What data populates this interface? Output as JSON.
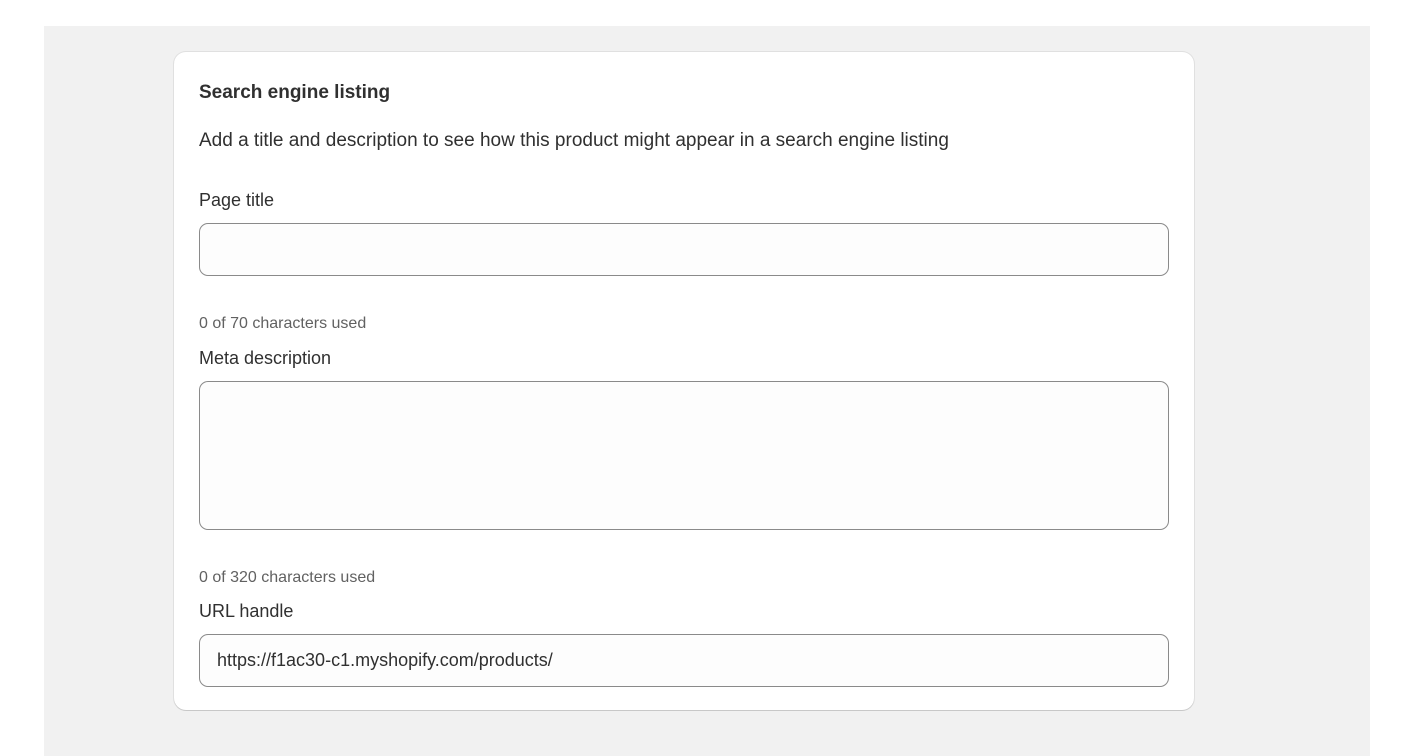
{
  "card": {
    "title": "Search engine listing",
    "description": "Add a title and description to see how this product might appear in a search engine listing"
  },
  "page_title": {
    "label": "Page title",
    "value": "",
    "help": "0 of 70 characters used"
  },
  "meta_description": {
    "label": "Meta description",
    "value": "",
    "help": "0 of 320 characters used"
  },
  "url_handle": {
    "label": "URL handle",
    "prefix": "https://f1ac30-c1.myshopify.com/products/",
    "value": ""
  },
  "colors": {
    "background": "#f1f1f1",
    "card": "#ffffff",
    "text": "#303030",
    "secondary_text": "#616161",
    "field_border": "#8a8a8a"
  }
}
